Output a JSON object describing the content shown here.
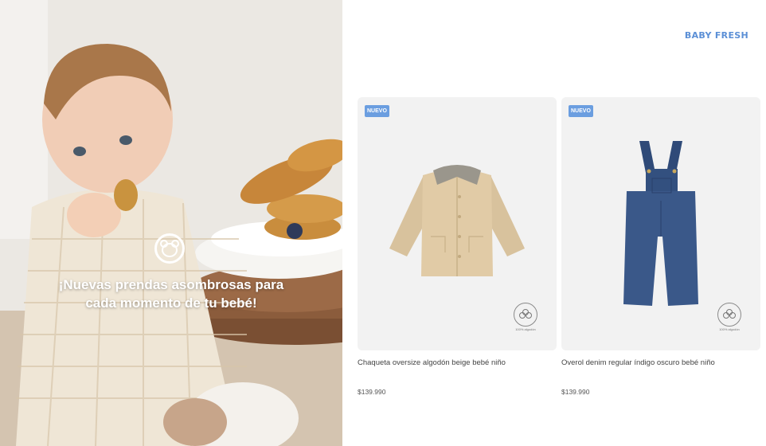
{
  "hero": {
    "caption_line1": "¡Nuevas prendas asombrosas para",
    "caption_line2": "cada momento de tu bebé!",
    "badge_icon": "teddy-bear-icon"
  },
  "header": {
    "brand": "BABY FRESH",
    "brand_color": "#5b8fd6"
  },
  "products": [
    {
      "badge": "NUEVO",
      "name": "Chaqueta oversize algodón beige bebé niño",
      "price": "$139.990",
      "cotton_label": "100% algodón",
      "image": "beige-jacket"
    },
    {
      "badge": "NUEVO",
      "name": "Overol denim regular índigo oscuro bebé niño",
      "price": "$139.990",
      "cotton_label": "100% algodón",
      "image": "denim-overall"
    }
  ],
  "colors": {
    "badge_bg": "#6b9ee0",
    "card_bg": "#f2f2f2"
  }
}
